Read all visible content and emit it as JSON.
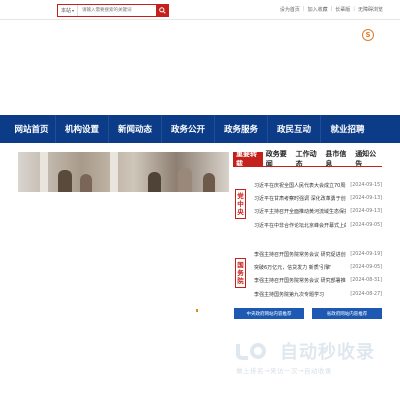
{
  "topbar": {
    "search_scope": "本站",
    "search_placeholder": "请输入需要搜索的关键词",
    "links": [
      "设为首页",
      "加入收藏",
      "长辈版",
      "无障碍浏览"
    ]
  },
  "old_version_label": "S",
  "nav": {
    "items": [
      "网站首页",
      "机构设置",
      "新闻动态",
      "政务公开",
      "政务服务",
      "政民互动",
      "就业招聘"
    ]
  },
  "tabs": [
    "重要转载",
    "政务要闻",
    "工作动态",
    "县市信息",
    "通知公告"
  ],
  "sections": {
    "party_central": {
      "label": "党中央",
      "items": [
        {
          "title": "习近平在庆祝全国人民代表大会成立70周年",
          "date": "[2024-09-15]"
        },
        {
          "title": "习近平在甘肃考察时强调 深化改革勇于创",
          "date": "[2024-09-13]"
        },
        {
          "title": "习近平主持召开全面推动黄河流域生态保护",
          "date": "[2024-09-13]"
        },
        {
          "title": "习近平在中非合作论坛北京峰会开幕式上的",
          "date": "[2024-09-05]"
        }
      ]
    },
    "state_council": {
      "label": "国务院",
      "items": [
        {
          "title": "李强主持召开国务院常务会议 研究促进创",
          "date": "[2024-09-19]"
        },
        {
          "title": "突破6万亿元，信贷发力 新质'引擎'",
          "date": "[2024-09-05]"
        },
        {
          "title": "李强主持召开国务院常务会议 研究部署推",
          "date": "[2024-08-31]"
        },
        {
          "title": "李强主持国务院第九次专题学习",
          "date": "[2024-08-27]"
        }
      ]
    }
  },
  "buttons": {
    "central_link": "中央政府网站内容推荐",
    "province_link": "省政府网站内容推荐"
  },
  "watermark": {
    "title": "自动秒收录",
    "subtitle": "做上排名→来访一次→自动收录"
  },
  "colors": {
    "nav_bg": "#0c3c88",
    "accent_red": "#c5211c",
    "button_blue": "#1d59b2"
  }
}
